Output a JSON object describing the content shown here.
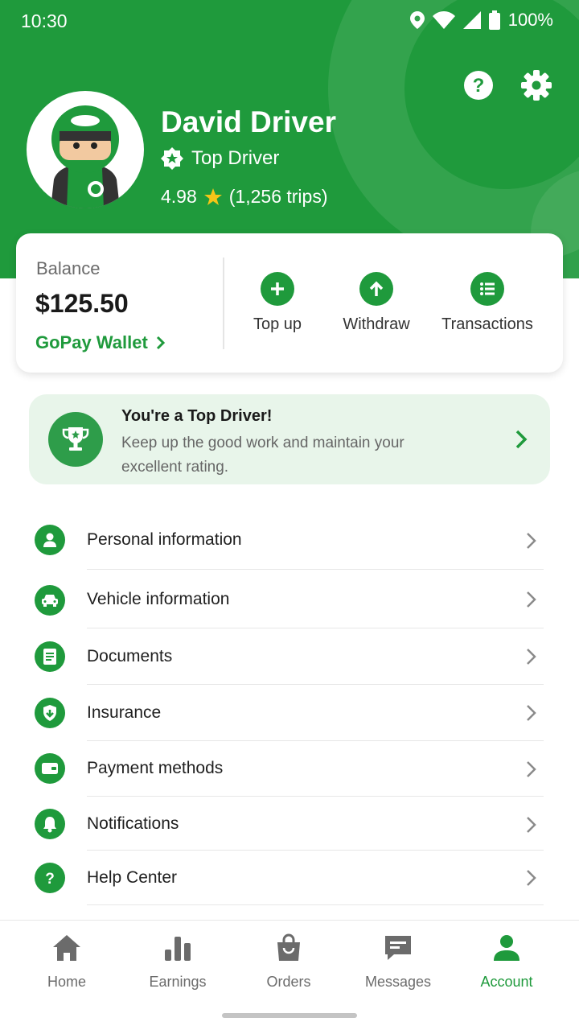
{
  "status": {
    "time": "10:30",
    "battery": "100%"
  },
  "profile": {
    "name": "David Driver",
    "badge": "Top Driver",
    "rating": "4.98",
    "trips": "(1,256 trips)"
  },
  "balance": {
    "label": "Balance",
    "amount": "$125.50",
    "wallet_link": "GoPay Wallet",
    "actions": [
      {
        "label": "Top up",
        "icon": "plus-icon"
      },
      {
        "label": "Withdraw",
        "icon": "arrow-up-icon"
      },
      {
        "label": "Transactions",
        "icon": "list-icon"
      }
    ]
  },
  "banner": {
    "title": "You're a Top Driver!",
    "text": "Keep up the good work and maintain your excellent rating."
  },
  "menu": [
    {
      "label": "Personal information",
      "icon": "person-icon"
    },
    {
      "label": "Vehicle information",
      "icon": "car-icon"
    },
    {
      "label": "Documents",
      "icon": "document-icon"
    },
    {
      "label": "Insurance",
      "icon": "shield-icon"
    },
    {
      "label": "Payment methods",
      "icon": "wallet-icon"
    },
    {
      "label": "Notifications",
      "icon": "bell-icon"
    },
    {
      "label": "Help Center",
      "icon": "help-icon"
    }
  ],
  "bottom_nav": [
    {
      "label": "Home",
      "icon": "home-icon",
      "active": false
    },
    {
      "label": "Earnings",
      "icon": "bar-chart-icon",
      "active": false
    },
    {
      "label": "Orders",
      "icon": "bag-icon",
      "active": false
    },
    {
      "label": "Messages",
      "icon": "message-icon",
      "active": false
    },
    {
      "label": "Account",
      "icon": "account-icon",
      "active": true
    }
  ],
  "colors": {
    "brand": "#1f9a3c",
    "banner_bg": "#e8f5ea",
    "star": "#f5c518"
  }
}
